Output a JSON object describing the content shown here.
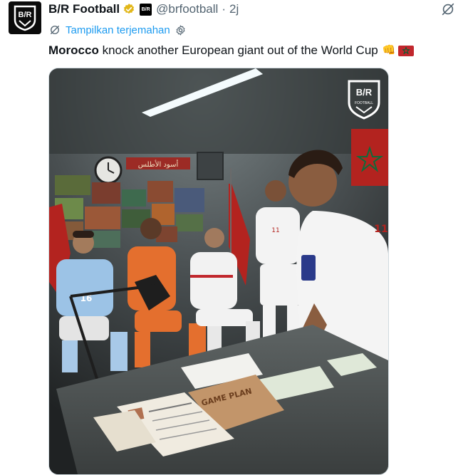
{
  "tweet": {
    "display_name": "B/R Football",
    "handle": "@brfootball",
    "separator": "·",
    "time": "2j",
    "affiliate_badge": "B/R",
    "avatar_text": "B/R",
    "translate_label": "Tampilkan terjemahan",
    "text_bold": "Morocco",
    "text_rest": " knock another European giant out of the World Cup",
    "emoji": "👊",
    "colors": {
      "link": "#1d9bf0",
      "muted": "#536471",
      "verified": "#e2b719",
      "flag_red": "#c1272d",
      "flag_green": "#006233"
    }
  },
  "media": {
    "logo_text_top": "B/R",
    "logo_text_bottom": "FOOTBALL",
    "banner_text": "أسود الأطلس",
    "folder_label": "GAME PLAN",
    "jersey_numbers": {
      "spain": "16",
      "standing_player": "11",
      "right_player": "11"
    }
  }
}
